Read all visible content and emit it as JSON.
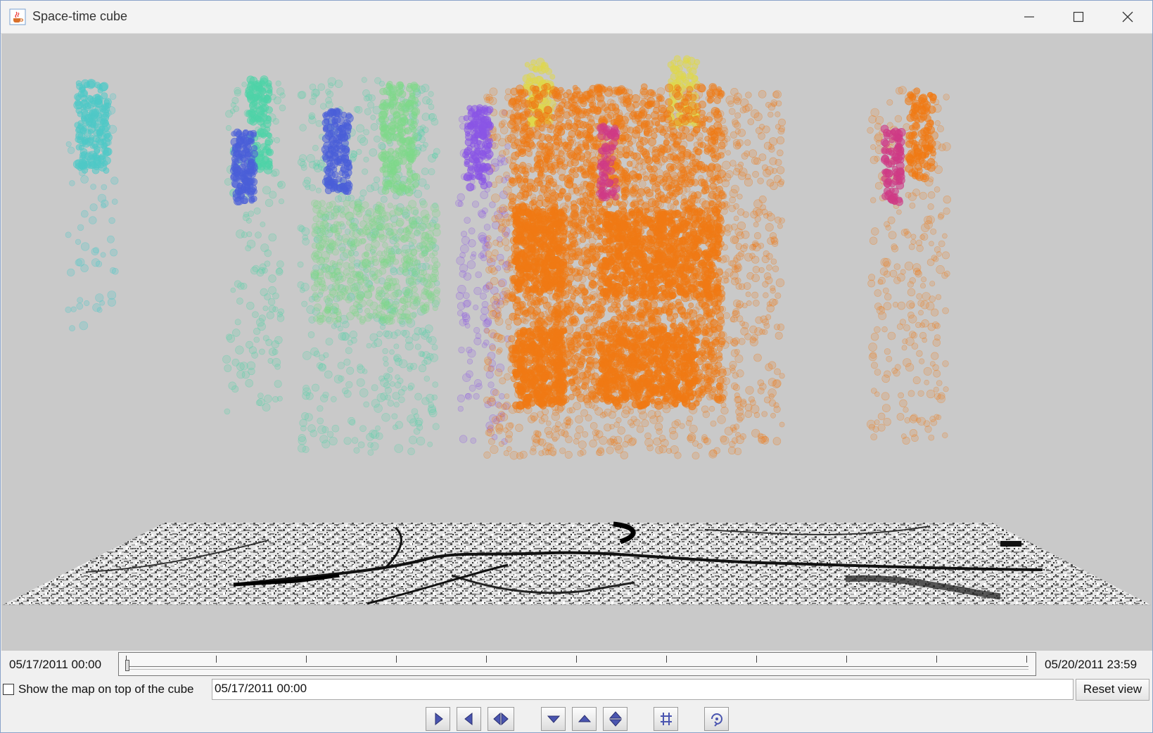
{
  "window": {
    "title": "Space-time cube",
    "icons": {
      "app": "java-cup-icon",
      "minimize": "minimize-icon",
      "maximize": "maximize-icon",
      "close": "close-icon"
    }
  },
  "timeline": {
    "start_label": "05/17/2011 00:00",
    "end_label": "05/20/2011 23:59",
    "position": 0
  },
  "controls": {
    "show_map_label": "Show the map on top of the cube",
    "show_map_checked": false,
    "current_time": "05/17/2011 00:00",
    "reset_label": "Reset view",
    "buttons": [
      "play-forward-icon",
      "play-backward-icon",
      "play-both-icon",
      "move-down-icon",
      "move-up-icon",
      "move-both-icon",
      "grid-icon",
      "rotate-icon"
    ]
  },
  "colors": {
    "cyan": "#4fc9c7",
    "teal": "#4fd3a7",
    "blue": "#4a5fd8",
    "green": "#7fd98a",
    "purple": "#8a55e6",
    "orange": "#f07a14",
    "yellow": "#e0d84a",
    "magenta": "#cf3a86",
    "background": "#c9c9c9"
  }
}
